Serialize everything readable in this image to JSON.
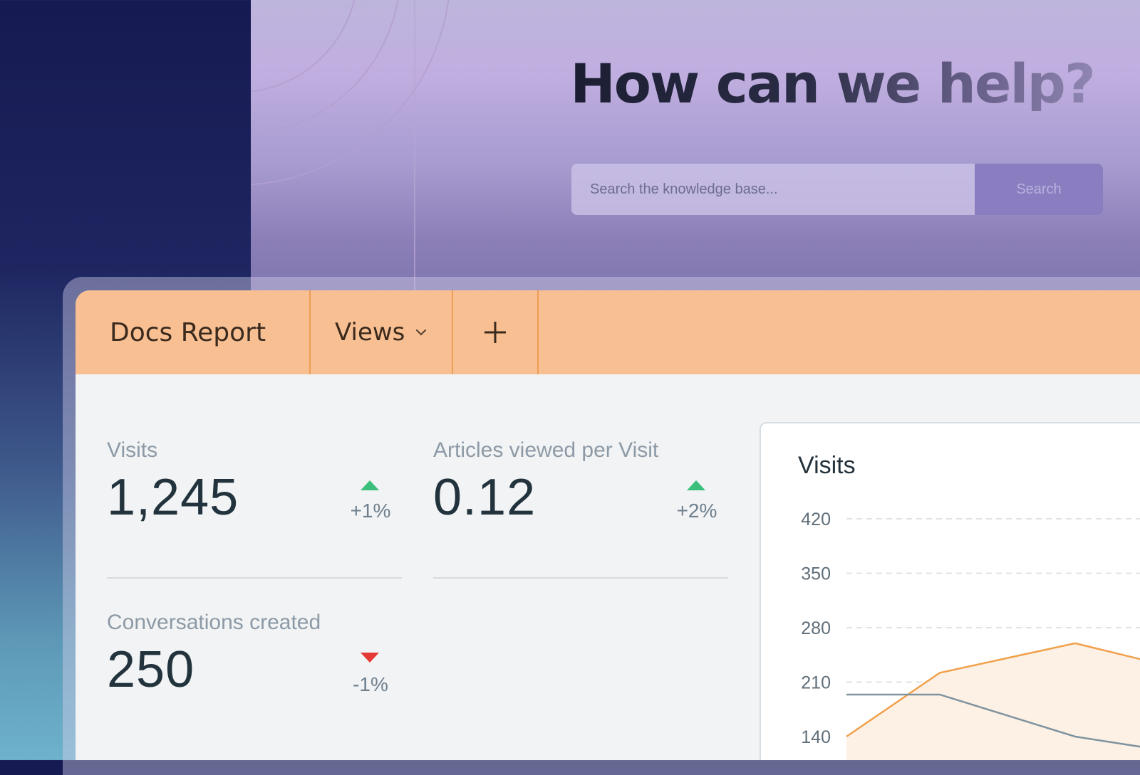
{
  "hero": {
    "title": "How can we help?",
    "search_placeholder": "Search the knowledge base...",
    "search_button": "Search"
  },
  "report": {
    "title": "Docs Report",
    "views_label": "Views",
    "add_icon": "plus-icon",
    "dropdown_icon": "chevron-down-icon"
  },
  "metrics": [
    {
      "label": "Visits",
      "value": "1,245",
      "change": "+1%",
      "direction": "up"
    },
    {
      "label": "Articles viewed per Visit",
      "value": "0.12",
      "change": "+2%",
      "direction": "up"
    },
    {
      "label": "Conversations created",
      "value": "250",
      "change": "-1%",
      "direction": "down"
    }
  ],
  "colors": {
    "accent": "#f8c092",
    "up": "#3bbf7a",
    "down": "#e53935",
    "series_orange": "#f0a04b",
    "series_gray": "#7f939f"
  },
  "chart_data": {
    "type": "line",
    "title": "Visits",
    "y_ticks": [
      420,
      350,
      280,
      210,
      140
    ],
    "ylim": [
      140,
      420
    ],
    "grid": true,
    "series": [
      {
        "color": "#f0a04b",
        "fill": true,
        "x": [
          0,
          1,
          2.45,
          3.2
        ],
        "values": [
          140,
          222,
          260,
          238
        ]
      },
      {
        "color": "#7f939f",
        "fill": false,
        "x": [
          0,
          1,
          2.45,
          3.2
        ],
        "values": [
          194,
          194,
          140,
          126
        ]
      }
    ]
  }
}
